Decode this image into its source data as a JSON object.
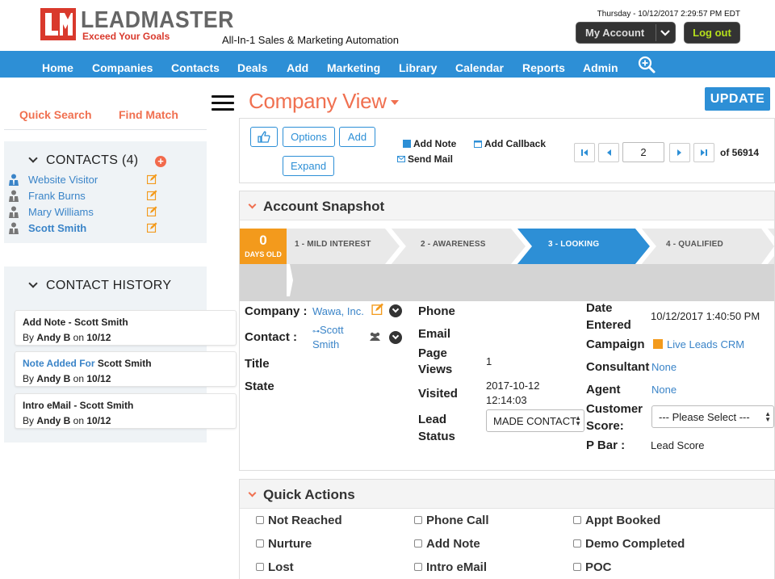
{
  "header": {
    "logo_name": "LEADMASTER",
    "logo_tagline": "Exceed Your Goals",
    "app_tagline": "All-In-1 Sales & Marketing Automation",
    "datetime": "Thursday  -  10/12/2017 2:29:57 PM EDT",
    "my_account": "My Account",
    "logout": "Log out"
  },
  "nav": [
    "Home",
    "Companies",
    "Contacts",
    "Deals",
    "Add",
    "Marketing",
    "Library",
    "Calendar",
    "Reports",
    "Admin"
  ],
  "left": {
    "quick_search": "Quick Search",
    "find_match": "Find Match",
    "contacts_title": "CONTACTS (4)",
    "contacts": [
      "Website Visitor",
      "Frank Burns",
      "Mary Williams",
      "Scott Smith"
    ],
    "history_title": "CONTACT HISTORY",
    "history": [
      {
        "title": "Add Note - Scott Smith",
        "title_prefix": "",
        "by_prefix": "By ",
        "by_user": "Andy B",
        "on_word": " on ",
        "date": "10/12"
      },
      {
        "title": "Scott Smith",
        "title_prefix": "Note Added For ",
        "by_prefix": "By ",
        "by_user": "Andy B",
        "on_word": " on ",
        "date": "10/12"
      },
      {
        "title": "Intro eMail - Scott Smith",
        "title_prefix": "",
        "by_prefix": "By ",
        "by_user": "Andy B",
        "on_word": " on ",
        "date": "10/12"
      }
    ]
  },
  "page": {
    "title": "Company View",
    "update": "UPDATE"
  },
  "toolbar": {
    "options": "Options",
    "add": "Add",
    "expand": "Expand",
    "add_note": "Add Note",
    "add_callback": "Add Callback",
    "send_mail": "Send Mail",
    "page_value": "2",
    "of_total": "of 56914"
  },
  "snapshot": {
    "title": "Account Snapshot",
    "days_count": "0",
    "days_label": "DAYS OLD",
    "stages": [
      "1 - MILD INTEREST",
      "2 - AWARENESS",
      "3 - LOOKING",
      "4 - QUALIFIED"
    ],
    "active_stage": 3,
    "company_label": "Company :",
    "company_value": "Wawa, Inc.",
    "contact_label": "Contact :",
    "contact_value_1": "Scott",
    "contact_value_2": "Smith",
    "title_label": "Title",
    "state_label": "State",
    "phone_label": "Phone",
    "email_label": "Email",
    "page_views_label_1": "Page",
    "page_views_label_2": "Views",
    "page_views_value": "1",
    "visited_label": "Visited",
    "visited_value_1": "2017-10-12",
    "visited_value_2": "12:14:03",
    "lead_status_label_1": "Lead",
    "lead_status_label_2": "Status",
    "lead_status_value": "MADE CONTACT",
    "date_entered_label_1": "Date",
    "date_entered_label_2": "Entered",
    "date_entered_value": "10/12/2017 1:40:50 PM",
    "campaign_label": "Campaign",
    "campaign_value": "Live Leads CRM",
    "consultant_label": "Consultant",
    "consultant_value": "None",
    "agent_label": "Agent",
    "agent_value": "None",
    "customer_score_label_1": "Customer",
    "customer_score_label_2": "Score:",
    "customer_score_value": "--- Please Select ---",
    "pbar_label": "P Bar :",
    "pbar_value": "Lead Score"
  },
  "quick_actions": {
    "title": "Quick Actions",
    "items": [
      "Not Reached",
      "Phone Call",
      "Appt Booked",
      "Nurture",
      "Add Note",
      "Demo Completed",
      "Lost",
      "Intro eMail",
      "POC"
    ]
  },
  "colors": {
    "brand_blue": "#2d8fd6",
    "accent_orange": "#f07050",
    "days_orange": "#f39a1c",
    "logout_green": "#b6e01c"
  }
}
